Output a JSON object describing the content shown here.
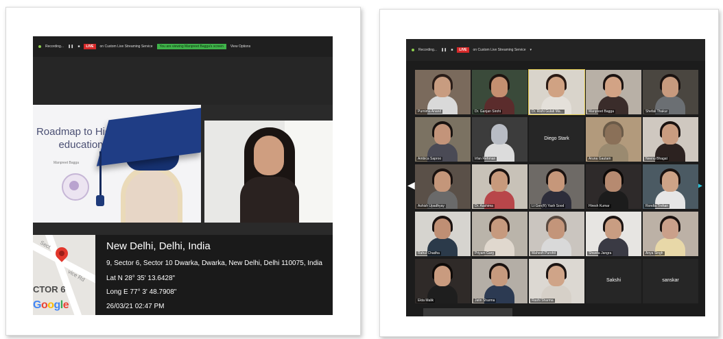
{
  "left_photo": {
    "toolbar": {
      "recording_label": "Recording...",
      "live_badge": "LIVE",
      "stream_label": "on Custom Live Streaming Service",
      "viewing_pill": "You are viewing Manpreet Bagga's screen",
      "view_options": "View Options"
    },
    "slide": {
      "title_line1": "Roadmap to Higher",
      "title_line2": "education",
      "author": "Manpreet Bagga"
    },
    "geo_stamp": {
      "city": "New Delhi, Delhi, India",
      "address": "9, Sector 6, Sector 10 Dwarka, Dwarka, New Delhi, Delhi 110075, India",
      "latitude": "Lat N 28° 35' 13.6428\"",
      "longitude": "Long E 77° 3' 48.7908\"",
      "timestamp": "26/03/21 02:47 PM",
      "map_sector_label": "CTOR 6",
      "map_road_label_1": "Sect",
      "map_road_label_2": "vice Rd",
      "map_brand": "Google"
    }
  },
  "right_photo": {
    "toolbar": {
      "recording_label": "Recording...",
      "live_badge": "LIVE",
      "stream_label": "on Custom Live Streaming Service"
    },
    "participants": [
      {
        "name": "Purnima Anand",
        "type": "video",
        "bg": "#7a6a5c",
        "skin": "#c89c80",
        "shirt": "#d9d9d9",
        "hair": "#2a1d18"
      },
      {
        "name": "Dr. Ganjan Sirohi",
        "type": "video",
        "bg": "#3a4a3a",
        "skin": "#c58f70",
        "shirt": "#5b2c2c",
        "hair": "#1d1410"
      },
      {
        "name": "Dr. Rishi Gulati Ma...",
        "type": "video",
        "bg": "#d9d4cb",
        "skin": "#d0a283",
        "shirt": "#e4e0da",
        "hair": "#2a1a14"
      },
      {
        "name": "Manpreet Bagga",
        "type": "video",
        "bg": "#b8b0a6",
        "skin": "#d2a385",
        "shirt": "#3a2c2a",
        "hair": "#1b1311"
      },
      {
        "name": "Shefali Thakur",
        "type": "video",
        "bg": "#4a4640",
        "skin": "#c79a7e",
        "shirt": "#6b6f73",
        "hair": "#1a1210"
      },
      {
        "name": "Ambica Saproo",
        "type": "video",
        "bg": "#7b7262",
        "skin": "#c3947a",
        "shirt": "#4a4a55",
        "hair": "#181210"
      },
      {
        "name": "Irfan Rehman",
        "type": "video",
        "bg": "#3c3c3c",
        "skin": "#b8bcc4",
        "shirt": "#dcdcdc",
        "hair": "#3a3a3a"
      },
      {
        "name": "Diego Stark",
        "type": "name"
      },
      {
        "name": "Aruna Gautam",
        "type": "video",
        "bg": "#b29a7c",
        "skin": "#8a7058",
        "shirt": "#9a8a70",
        "hair": "#6a5a48"
      },
      {
        "name": "Neenu Bhagat",
        "type": "video",
        "bg": "#cfc8c0",
        "skin": "#c99c80",
        "shirt": "#2c2220",
        "hair": "#1a1210"
      },
      {
        "name": "Ashish Upadhyay",
        "type": "video",
        "bg": "#5a5048",
        "skin": "#c4967a",
        "shirt": "#6a6a6a",
        "hair": "#1a1210"
      },
      {
        "name": "Dr. Aashima",
        "type": "video",
        "bg": "#c8c2b8",
        "skin": "#c89a7c",
        "shirt": "#b8464a",
        "hair": "#1a1210"
      },
      {
        "name": "Lt Gen(R) Yash Sood",
        "type": "video",
        "bg": "#6e6a66",
        "skin": "#c6977a",
        "shirt": "#2d2d3a",
        "hair": "#1a1210"
      },
      {
        "name": "Hiresh Kumar",
        "type": "video",
        "bg": "#2e2a2a",
        "skin": "#b68a70",
        "shirt": "#1c1c1c",
        "hair": "#0e0a08"
      },
      {
        "name": "Rondta Trehan",
        "type": "video",
        "bg": "#4b5a63",
        "skin": "#cda387",
        "shirt": "#e6e6e6",
        "hair": "#1a1210"
      },
      {
        "name": "Rahul Chadha",
        "type": "video",
        "bg": "#d6d4cf",
        "skin": "#bf8f74",
        "shirt": "#2b3a4a",
        "hair": "#1a1210"
      },
      {
        "name": "Priyam Garg",
        "type": "video",
        "bg": "#bab4aa",
        "skin": "#c69a7e",
        "shirt": "#e0d8ce",
        "hair": "#2a1a14"
      },
      {
        "name": "Mahesh Purohit",
        "type": "video",
        "bg": "#cac5bf",
        "skin": "#c3957a",
        "shirt": "#d9d9d9",
        "hair": "#5a4a40"
      },
      {
        "name": "Shweta Jangra",
        "type": "video",
        "bg": "#e7e5e2",
        "skin": "#c99d82",
        "shirt": "#3a3a44",
        "hair": "#1c1412"
      },
      {
        "name": "Anya Singh",
        "type": "video",
        "bg": "#bcb1a6",
        "skin": "#caa08a",
        "shirt": "#e8d8a8",
        "hair": "#1a1210"
      },
      {
        "name": "Ekta Malik",
        "type": "video",
        "bg": "#2f2a28",
        "skin": "#c99b7f",
        "shirt": "#1e1e1e",
        "hair": "#0e0a08"
      },
      {
        "name": "Jatin Sharma",
        "type": "video",
        "bg": "#b4aea6",
        "skin": "#c69a7e",
        "shirt": "#2c3a52",
        "hair": "#1a1210"
      },
      {
        "name": "Rashi Sharma",
        "type": "video",
        "bg": "#dcd8d2",
        "skin": "#cfa488",
        "shirt": "#d6d0c8",
        "hair": "#1c1412"
      },
      {
        "name": "Sakshi",
        "type": "name"
      },
      {
        "name": "sanskar",
        "type": "name"
      }
    ]
  }
}
